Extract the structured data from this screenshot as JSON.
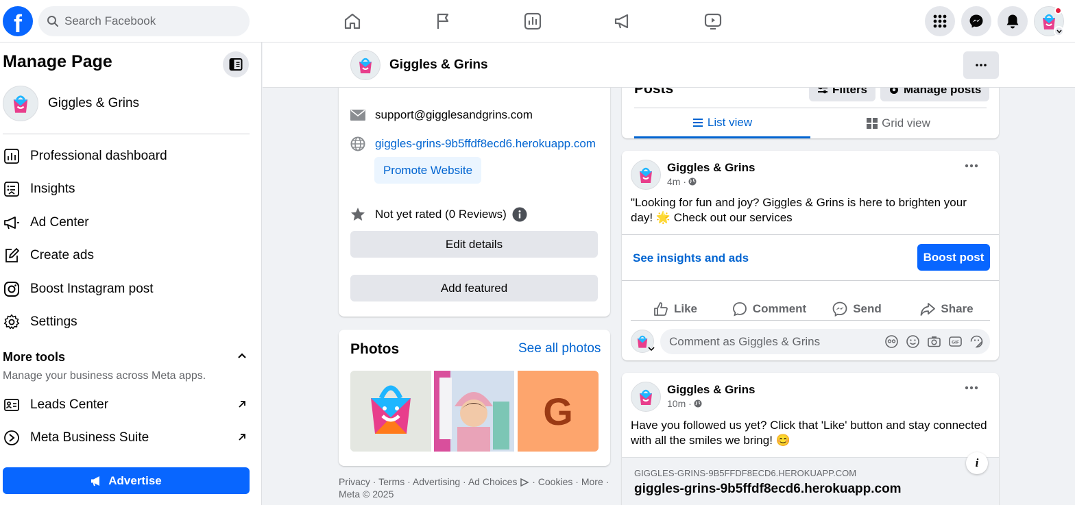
{
  "topbar": {
    "logo_letter": "f",
    "search_placeholder": "Search Facebook",
    "nav_icons": [
      "home-icon",
      "flag-icon",
      "insights-icon",
      "megaphone-icon",
      "video-icon"
    ],
    "right_icons": [
      "menu-grid-icon",
      "messenger-icon",
      "bell-icon"
    ]
  },
  "sidebar": {
    "title": "Manage Page",
    "page_name": "Giggles & Grins",
    "items": [
      {
        "label": "Professional dashboard",
        "icon": "dashboard-icon"
      },
      {
        "label": "Insights",
        "icon": "insights-icon"
      },
      {
        "label": "Ad Center",
        "icon": "megaphone-icon"
      },
      {
        "label": "Create ads",
        "icon": "pencil-icon"
      },
      {
        "label": "Boost Instagram post",
        "icon": "instagram-icon"
      },
      {
        "label": "Settings",
        "icon": "gear-icon"
      }
    ],
    "more_tools": {
      "title": "More tools",
      "subtitle": "Manage your business across Meta apps."
    },
    "tools": [
      {
        "label": "Leads Center",
        "icon": "leads-icon"
      },
      {
        "label": "Meta Business Suite",
        "icon": "meta-suite-icon"
      }
    ],
    "advertise_label": "Advertise"
  },
  "page_header": {
    "name": "Giggles & Grins"
  },
  "intro": {
    "email": "support@gigglesandgrins.com",
    "website": "giggles-grins-9b5ffdf8ecd6.herokuapp.com",
    "promote_label": "Promote Website",
    "rating": "Not yet rated (0 Reviews)",
    "edit_label": "Edit details",
    "featured_label": "Add featured"
  },
  "photos": {
    "title": "Photos",
    "see_all": "See all photos",
    "third_letter": "G"
  },
  "footer": {
    "links": [
      "Privacy",
      "Terms",
      "Advertising",
      "Ad Choices",
      "Cookies",
      "More"
    ],
    "copyright": "Meta © 2025"
  },
  "posts": {
    "title": "Posts",
    "filters_label": "Filters",
    "manage_label": "Manage posts",
    "list_view": "List view",
    "grid_view": "Grid view"
  },
  "post1": {
    "author": "Giggles & Grins",
    "time": "4m ·",
    "text": "\"Looking for fun and joy? Giggles & Grins is here to brighten your day! 🌟 Check out our services",
    "insights_link": "See insights and ads",
    "boost_label": "Boost post",
    "actions": [
      "Like",
      "Comment",
      "Send",
      "Share"
    ],
    "comment_placeholder": "Comment as Giggles & Grins"
  },
  "post2": {
    "author": "Giggles & Grins",
    "time": "10m ·",
    "text": "Have you followed us yet? Click that 'Like' button and stay connected with all the smiles we bring! 😊",
    "link_domain": "GIGGLES-GRINS-9B5FFDF8ECD6.HEROKUAPP.COM",
    "link_title": "giggles-grins-9b5ffdf8ecd6.herokuapp.com"
  },
  "colors": {
    "accent": "#0866ff",
    "link": "#0064d1",
    "background": "#f0f2f5"
  }
}
